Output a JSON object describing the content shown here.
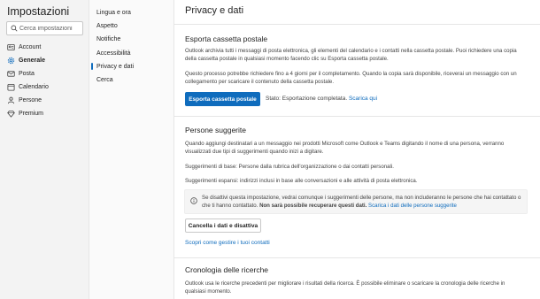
{
  "app": {
    "title": "Impostazioni"
  },
  "search": {
    "placeholder": "Cerca impostazioni"
  },
  "left_nav": {
    "items": [
      {
        "label": "Account",
        "icon": "person-card-icon"
      },
      {
        "label": "Generale",
        "icon": "gear-icon",
        "active": true
      },
      {
        "label": "Posta",
        "icon": "mail-icon"
      },
      {
        "label": "Calendario",
        "icon": "calendar-icon"
      },
      {
        "label": "Persone",
        "icon": "people-icon"
      },
      {
        "label": "Premium",
        "icon": "diamond-icon"
      }
    ]
  },
  "sub_nav": {
    "items": [
      {
        "label": "Lingua e ora"
      },
      {
        "label": "Aspetto"
      },
      {
        "label": "Notifiche"
      },
      {
        "label": "Accessibilità"
      },
      {
        "label": "Privacy e dati",
        "active": true
      },
      {
        "label": "Cerca"
      }
    ]
  },
  "main": {
    "title": "Privacy e dati",
    "export": {
      "title": "Esporta cassetta postale",
      "description": "Outlook archivia tutti i messaggi di posta elettronica, gli elementi del calendario e i contatti nella cassetta postale. Puoi richiedere una copia della cassetta postale in qualsiasi momento facendo clic su Esporta cassetta postale.",
      "note": "Questo processo potrebbe richiedere fino a 4 giorni per il completamento. Quando la copia sarà disponibile, riceverai un messaggio con un collegamento per scaricare il contenuto della cassetta postale.",
      "button_label": "Esporta cassetta postale",
      "status_text": "Stato: Esportazione completata.",
      "download_link": "Scarica qui"
    },
    "people": {
      "title": "Persone suggerite",
      "description": "Quando aggiungi destinatari a un messaggio nei prodotti Microsoft come Outlook e Teams digitando il nome di una persona, verranno visualizzati due tipi di suggerimenti quando inizi a digitare.",
      "basic": "Suggerimenti di base: Persone dalla rubrica dell'organizzazione o dai contatti personali.",
      "expanded": "Suggerimenti espansi: indirizzi inclusi in base alle conversazioni e alle attività di posta elettronica.",
      "info_text": "Se disattivi questa impostazione, vedrai comunque i suggerimenti delle persone, ma non includeranno le persone che hai contattato o che ti hanno contattato.",
      "info_bold": "Non sarà possibile recuperare questi dati.",
      "info_link": "Scarica i dati delle persone suggerite",
      "clear_button": "Cancella i dati e disattiva",
      "manage_link": "Scopri come gestire i tuoi contatti"
    },
    "history": {
      "title": "Cronologia delle ricerche",
      "description": "Outlook usa le ricerche precedenti per migliorare i risultati della ricerca. È possibile eliminare o scaricare la cronologia delle ricerche in qualsiasi momento."
    }
  },
  "colors": {
    "accent": "#0f6cbd",
    "nav_bg": "#f3f3f3",
    "info_bg": "#f5f5f5"
  }
}
